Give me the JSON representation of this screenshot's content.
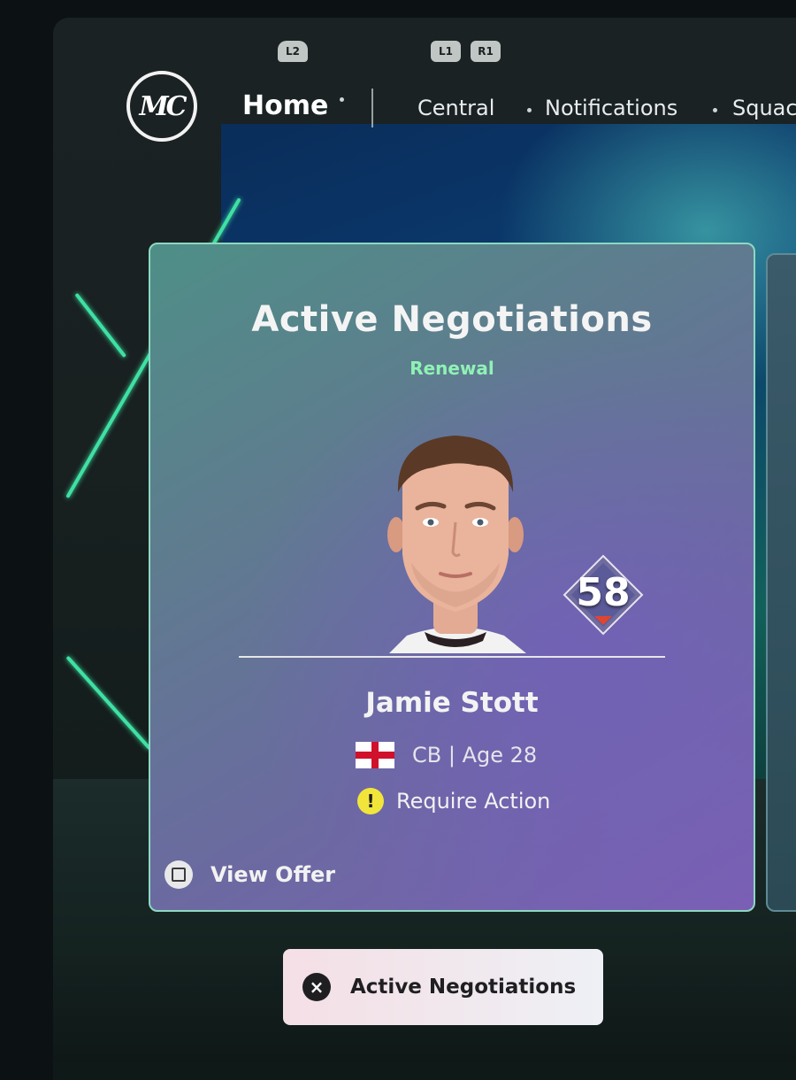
{
  "controller_hints": {
    "l2": "L2",
    "l1": "L1",
    "r1": "R1"
  },
  "logo": {
    "text": "MC"
  },
  "nav": {
    "home": "Home",
    "tabs": [
      "Central",
      "Notifications",
      "Squac"
    ]
  },
  "card": {
    "title": "Active Negotiations",
    "subtitle": "Renewal",
    "player": {
      "name": "Jamie Stott",
      "meta": "CB | Age 28",
      "rating": "58",
      "flag": "England"
    },
    "status": "Require Action",
    "view_offer": "View Offer"
  },
  "bottom_button": {
    "label": "Active Negotiations"
  },
  "colors": {
    "accent_green": "#3fe0a4",
    "subtitle_green": "#8ff2b5",
    "warning_yellow": "#f1e53b",
    "rating_arrow_red": "#e0452f"
  },
  "icons": {
    "warning": "exclamation-icon",
    "view_offer": "square-button-icon",
    "close": "x-button-icon"
  }
}
